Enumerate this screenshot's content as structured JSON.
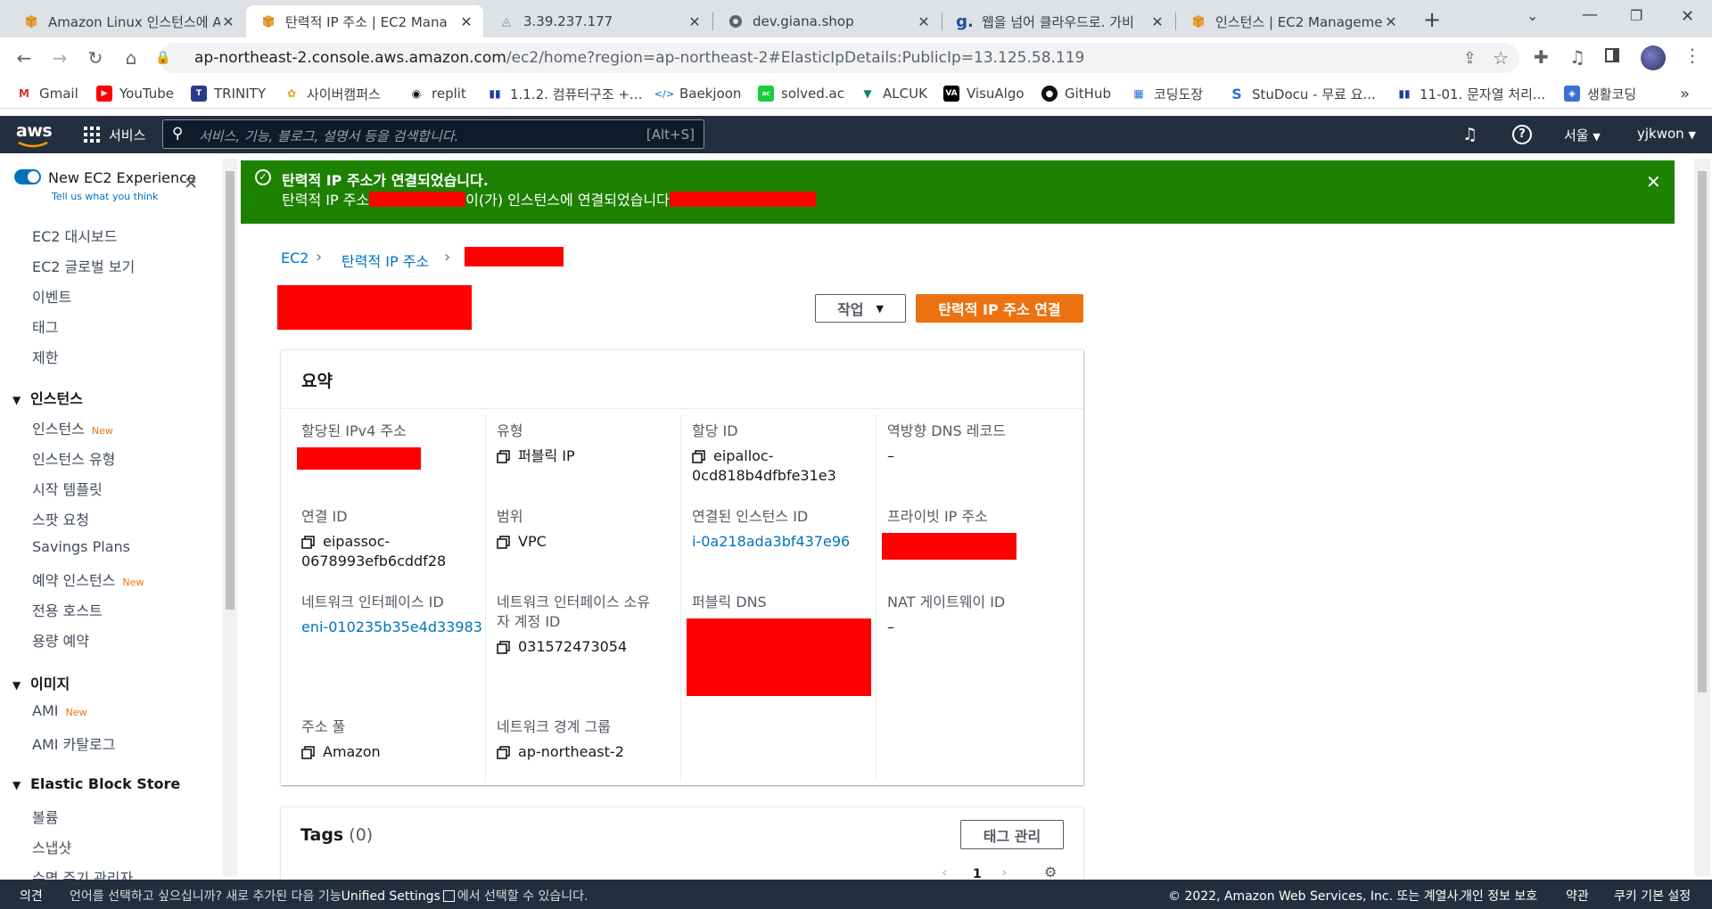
{
  "browser": {
    "tabs": [
      {
        "title": "Amazon Linux 인스턴스에 A",
        "icon": "aws-box-icon"
      },
      {
        "title": "탄력적 IP 주소 | EC2 Mana",
        "icon": "aws-box-icon"
      },
      {
        "title": "3.39.237.177",
        "icon": "page-icon"
      },
      {
        "title": "dev.giana.shop",
        "icon": "globe-icon"
      },
      {
        "title": "웹을 넘어 클라우드로. 가비",
        "icon": "g-icon"
      },
      {
        "title": "인스턴스 | EC2 Manageme",
        "icon": "aws-box-icon"
      }
    ],
    "url_host": "ap-northeast-2.console.aws.amazon.com",
    "url_path": "/ec2/home?region=ap-northeast-2#ElasticIpDetails:PublicIp=13.125.58.119",
    "bookmarks": [
      "Gmail",
      "YouTube",
      "TRINITY",
      "사이버캠퍼스",
      "replit",
      "1.1.2. 컴퓨터구조 +...",
      "Baekjoon",
      "solved.ac",
      "ALCUK",
      "VisuAlgo",
      "GitHub",
      "코딩도장",
      "StuDocu - 무료 요...",
      "11-01. 문자열 처리...",
      "생활코딩"
    ],
    "more": "»"
  },
  "aws": {
    "logo": "aws",
    "services": "서비스",
    "search_placeholder": "서비스, 기능, 블로그, 설명서 등을 검색합니다.",
    "search_shortcut": "[Alt+S]",
    "region": "서울",
    "user": "yjkwon"
  },
  "sidebar": {
    "toggle_label": "New EC2 Experience",
    "toggle_sub": "Tell us what you think",
    "top_items": [
      "EC2 대시보드",
      "EC2 글로벌 보기",
      "이벤트",
      "태그",
      "제한"
    ],
    "sections": [
      {
        "title": "인스턴스",
        "items": [
          {
            "label": "인스턴스",
            "badge": "New"
          },
          {
            "label": "인스턴스 유형",
            "badge": ""
          },
          {
            "label": "시작 템플릿",
            "badge": ""
          },
          {
            "label": "스팟 요청",
            "badge": ""
          },
          {
            "label": "Savings Plans",
            "badge": ""
          },
          {
            "label": "예약 인스턴스",
            "badge": "New"
          },
          {
            "label": "전용 호스트",
            "badge": ""
          },
          {
            "label": "용량 예약",
            "badge": ""
          }
        ]
      },
      {
        "title": "이미지",
        "items": [
          {
            "label": "AMI",
            "badge": "New"
          },
          {
            "label": "AMI 카탈로그",
            "badge": ""
          }
        ]
      },
      {
        "title": "Elastic Block Store",
        "items": [
          {
            "label": "볼륨",
            "badge": ""
          },
          {
            "label": "스냅샷",
            "badge": ""
          },
          {
            "label": "수명 주기 관리자",
            "badge": ""
          }
        ]
      }
    ]
  },
  "banner": {
    "title": "탄력적 IP 주소가 연결되었습니다.",
    "msg_a": "탄력적 IP 주소",
    "msg_b": "이(가) 인스턴스에 연결되었습니다"
  },
  "breadcrumb": [
    "EC2",
    "탄력적 IP 주소"
  ],
  "actions": {
    "menu": "작업",
    "primary": "탄력적 IP 주소 연결"
  },
  "summary": {
    "title": "요약",
    "fields": {
      "ipv4_label": "할당된 IPv4 주소",
      "type_label": "유형",
      "type_value": "퍼블릭 IP",
      "alloc_label": "할당 ID",
      "alloc_value_1": "eipalloc-",
      "alloc_value_2": "0cd818b4dfbfe31e3",
      "rdns_label": "역방향 DNS 레코드",
      "rdns_value": "–",
      "assoc_label": "연결 ID",
      "assoc_value_1": "eipassoc-",
      "assoc_value_2": "0678993efb6cddf28",
      "scope_label": "범위",
      "scope_value": "VPC",
      "instance_label": "연결된 인스턴스 ID",
      "instance_value": "i-0a218ada3bf437e96",
      "private_ip_label": "프라이빗 IP 주소",
      "eni_label": "네트워크 인터페이스 ID",
      "eni_value": "eni-010235b35e4d33983",
      "owner_label_1": "네트워크 인터페이스 소유",
      "owner_label_2": "자 계정 ID",
      "owner_value": "031572473054",
      "public_dns_label": "퍼블릭 DNS",
      "nat_label": "NAT 게이트웨이 ID",
      "nat_value": "–",
      "pool_label": "주소 풀",
      "pool_value": "Amazon",
      "border_label": "네트워크 경계 그룹",
      "border_value": "ap-northeast-2"
    }
  },
  "tags": {
    "title": "Tags",
    "count": "(0)",
    "manage": "태그 관리",
    "page": "1"
  },
  "footer": {
    "feedback": "의견",
    "lang_text": "언어를 선택하고 싶으십니까? 새로 추가된 다음 기능",
    "unified": "Unified Settings",
    "lang_text2": "에서 선택할 수 있습니다.",
    "copyright": "© 2022, Amazon Web Services, Inc. 또는 계열사.",
    "privacy": "개인 정보 보호",
    "terms": "약관",
    "cookies": "쿠키 기본 설정"
  },
  "colors": {
    "aws_nav": "#232f3e",
    "success": "#1d8102",
    "primary": "#ec7211",
    "link": "#0073bb",
    "redaction": "#ff0000"
  }
}
